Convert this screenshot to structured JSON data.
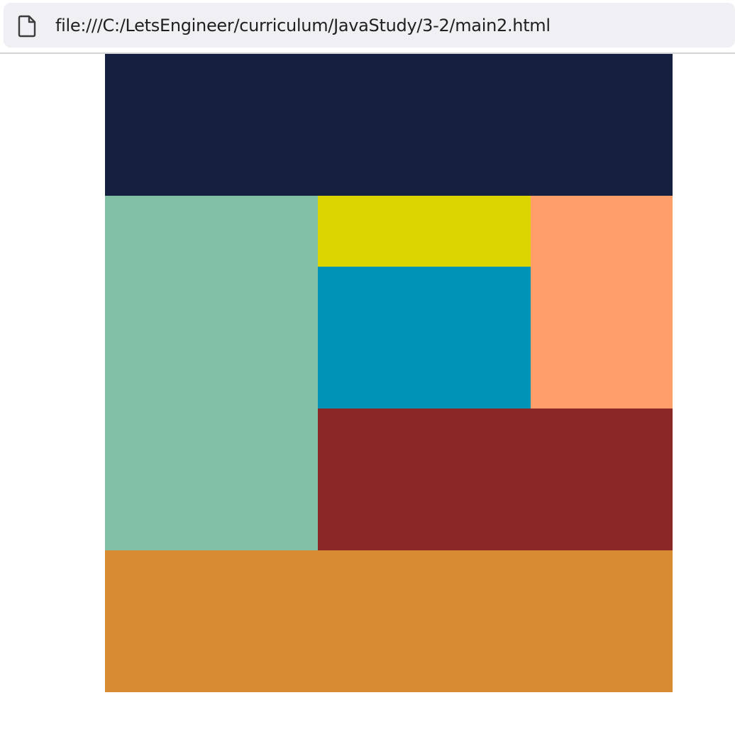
{
  "browser": {
    "address_bar": {
      "url": "file:///C:/LetsEngineer/curriculum/JavaStudy/3-2/main2.html",
      "icon": "file-icon"
    }
  },
  "page": {
    "blocks": [
      {
        "name": "header-block",
        "color": "#152040"
      },
      {
        "name": "left-block",
        "color": "#81c0a7"
      },
      {
        "name": "yellow-block",
        "color": "#dcd400"
      },
      {
        "name": "blue-block",
        "color": "#0093b8"
      },
      {
        "name": "orange-block",
        "color": "#ff9d6b"
      },
      {
        "name": "red-block",
        "color": "#8b2727"
      },
      {
        "name": "footer-block",
        "color": "#d98b31"
      }
    ]
  }
}
